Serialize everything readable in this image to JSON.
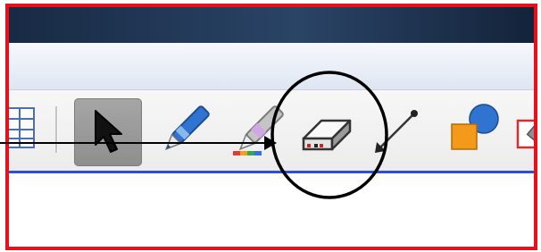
{
  "window": {
    "titlebar_color": "#1f3553",
    "frame_color": "#e8101a"
  },
  "toolbar": {
    "underline_color": "#2b4fd6",
    "tools": [
      {
        "name": "table-tool",
        "icon": "table-icon"
      },
      {
        "name": "select-tool",
        "icon": "arrow-pointer-icon",
        "selected": true
      },
      {
        "name": "pen-tool",
        "icon": "pen-icon"
      },
      {
        "name": "creative-pen-tool",
        "icon": "rainbow-pen-icon"
      },
      {
        "name": "eraser-tool",
        "icon": "eraser-icon",
        "highlighted": true
      },
      {
        "name": "line-tool",
        "icon": "line-icon"
      },
      {
        "name": "shapes-tool",
        "icon": "shapes-icon"
      },
      {
        "name": "magic-pen-tool",
        "icon": "magic-pen-icon"
      }
    ]
  },
  "annotation": {
    "callout": "black-arrow-and-circle-around-eraser"
  }
}
